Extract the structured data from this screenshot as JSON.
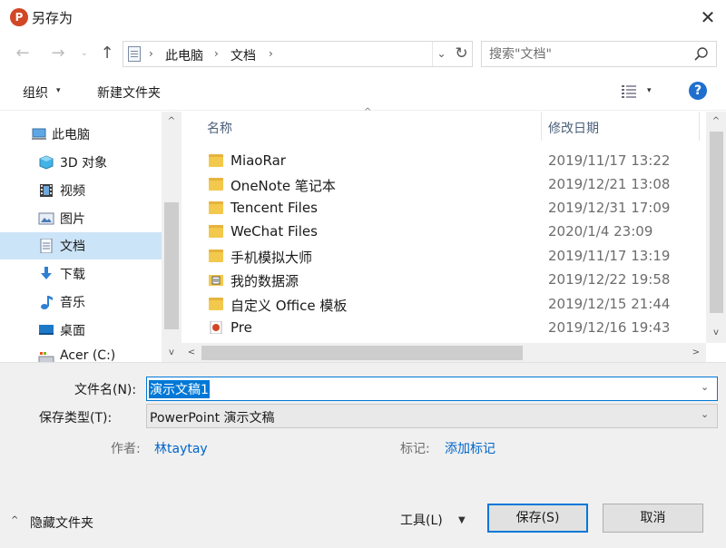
{
  "window": {
    "title": "另存为",
    "app_icon": "P",
    "close_glyph": "✕"
  },
  "nav": {
    "back_glyph": "←",
    "forward_glyph": "→",
    "recent_glyph": "⌄",
    "up_glyph": "↑"
  },
  "address": {
    "sep": "›",
    "crumbs": [
      "此电脑",
      "文档"
    ],
    "dropdown_glyph": "⌄",
    "refresh_glyph": "↻"
  },
  "search": {
    "placeholder": "搜索\"文档\""
  },
  "toolbar": {
    "organize_label": "组织",
    "caret": "▾",
    "new_folder_label": "新建文件夹",
    "help_glyph": "?"
  },
  "sidebar": {
    "items": [
      {
        "label": "此电脑",
        "icon": "computer-icon"
      },
      {
        "label": "3D 对象",
        "icon": "3d-objects-icon"
      },
      {
        "label": "视频",
        "icon": "video-icon"
      },
      {
        "label": "图片",
        "icon": "pictures-icon"
      },
      {
        "label": "文档",
        "icon": "documents-icon",
        "selected": true
      },
      {
        "label": "下载",
        "icon": "download-icon"
      },
      {
        "label": "音乐",
        "icon": "music-icon"
      },
      {
        "label": "桌面",
        "icon": "desktop-icon"
      },
      {
        "label": "Acer (C:)",
        "icon": "drive-icon"
      }
    ],
    "scroll_up_glyph": "^",
    "scroll_down_glyph": "v"
  },
  "filelist": {
    "columns": {
      "name": "名称",
      "date": "修改日期"
    },
    "sort_glyph": "^",
    "rows": [
      {
        "name": "MiaoRar",
        "date": "2019/11/17 13:22",
        "type": "folder"
      },
      {
        "name": "OneNote 笔记本",
        "date": "2019/12/21 13:08",
        "type": "folder"
      },
      {
        "name": "Tencent Files",
        "date": "2019/12/31 17:09",
        "type": "folder"
      },
      {
        "name": "WeChat Files",
        "date": "2020/1/4 23:09",
        "type": "folder"
      },
      {
        "name": "手机模拟大师",
        "date": "2019/11/17 13:19",
        "type": "folder"
      },
      {
        "name": "我的数据源",
        "date": "2019/12/22 19:58",
        "type": "datasource"
      },
      {
        "name": "自定义 Office 模板",
        "date": "2019/12/15 21:44",
        "type": "folder"
      },
      {
        "name": "Pre",
        "date": "2019/12/16 19:43",
        "type": "pptx"
      }
    ],
    "scroll_up_glyph": "^",
    "scroll_down_glyph": "v",
    "scroll_left_glyph": "<",
    "scroll_right_glyph": ">"
  },
  "form": {
    "filename_label": "文件名(N):",
    "filename_value": "演示文稿1",
    "filetype_label": "保存类型(T):",
    "filetype_value": "PowerPoint 演示文稿",
    "dropdown_glyph": "⌄",
    "author_label": "作者:",
    "author_value": "林taytay",
    "tags_label": "标记:",
    "tags_value": "添加标记"
  },
  "footer": {
    "hide_folders_caret": "^",
    "hide_folders_label": "隐藏文件夹",
    "tools_label": "工具(L)",
    "tools_caret": "▼",
    "save_label": "保存(S)",
    "cancel_label": "取消"
  },
  "colors": {
    "accent": "#0078d7",
    "selected_bg": "#cce4f7",
    "link": "#0066cc",
    "folder": "#f2c94c",
    "ppt": "#d24726"
  }
}
